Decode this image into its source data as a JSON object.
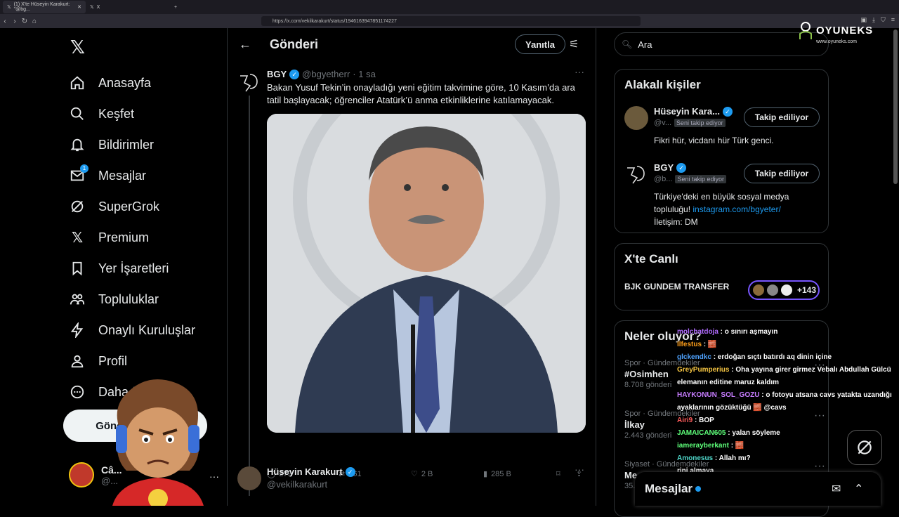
{
  "browser": {
    "active_tab_title": "(1) X'te Hüseyin Karakurt: \"@bg...",
    "second_tab_title": "X",
    "url": "https://x.com/vekilkarakurt/status/1946163947851174227"
  },
  "sidebar": {
    "items": [
      {
        "label": "Anasayfa",
        "icon": "home-icon"
      },
      {
        "label": "Keşfet",
        "icon": "search-icon"
      },
      {
        "label": "Bildirimler",
        "icon": "bell-icon"
      },
      {
        "label": "Mesajlar",
        "icon": "mail-icon",
        "badge": "1"
      },
      {
        "label": "SuperGrok",
        "icon": "grok-icon"
      },
      {
        "label": "Premium",
        "icon": "x-logo-icon"
      },
      {
        "label": "Yer İşaretleri",
        "icon": "bookmark-icon"
      },
      {
        "label": "Topluluklar",
        "icon": "communities-icon"
      },
      {
        "label": "Onaylı Kuruluşlar",
        "icon": "lightning-icon"
      },
      {
        "label": "Profil",
        "icon": "person-icon"
      },
      {
        "label": "Daha fazla",
        "icon": "more-circle-icon"
      }
    ],
    "post_button": "Gönderi yayınla",
    "account_name": "Câ...",
    "account_handle": "@..."
  },
  "main": {
    "title": "Gönderi",
    "reply_button": "Yanıtla",
    "tweet": {
      "name": "BGY",
      "handle": "@bgyetherr",
      "time": "· 1 sa",
      "text": "Bakan Yusuf Tekin’in onayladığı yeni eğitim takvimine göre, 10 Kasım’da ara tatil başlayacak; öğrenciler Atatürk’ü anma etkinliklerine katılamayacak.",
      "replies": "279",
      "reposts": "361",
      "likes": "2 B",
      "views": "285 B"
    },
    "reply": {
      "name": "Hüseyin Karakurt",
      "handle": "@vekilkarakurt"
    }
  },
  "right": {
    "search_placeholder": "Ara",
    "related_title": "Alakalı kişiler",
    "people": [
      {
        "name": "Hüseyin Kara...",
        "handle": "@v...",
        "follows_you": "Seni takip ediyor",
        "button": "Takip ediliyor",
        "bio": "Fikri hür, vicdanı hür Türk genci."
      },
      {
        "name": "BGY",
        "handle": "@b...",
        "follows_you": "Seni takip ediyor",
        "button": "Takip ediliyor",
        "bio_1": "Türkiye'deki en büyük sosyal medya topluluğu!",
        "bio_link": "instagram.com/bgyeter/",
        "bio_2": "İletişim: DM"
      }
    ],
    "live_title": "X'te Canlı",
    "live_item": "BJK GUNDEM TRANSFER",
    "live_count": "+143",
    "trends_title": "Neler oluyor?",
    "trends": [
      {
        "category": "Spor · Gündemdekiler",
        "name": "#Osimhen",
        "count": "8.708 gönderi"
      },
      {
        "category": "Spor · Gündemdekiler",
        "name": "İlkay",
        "count": "2.443 gönderi"
      },
      {
        "category": "Siyaset · Gündemdekiler",
        "name": "Me...",
        "count": "35..."
      }
    ]
  },
  "messages_dock": {
    "title": "Mesajlar"
  },
  "overlay": {
    "brand": "OYUNEKS",
    "brand_url": "www.oyuneks.com",
    "chat": [
      {
        "user": "molchatdoja",
        "msg": ": o sınırı aşmayın",
        "color": "#b16bff"
      },
      {
        "user": "Ilfestus",
        "msg": ": 🧱",
        "color": "#ff9f1a"
      },
      {
        "user": "glckendkc",
        "msg": ": erdoğan sıçtı batırdı aq dinin içine",
        "color": "#4fa3ff"
      },
      {
        "user": "GreyPumperius",
        "msg": ": Oha yayına girer girmez Vebalı Abdullah Gülcü elemanın editine maruz kaldım",
        "color": "#f5c542"
      },
      {
        "user": "HAYKONUN_SOL_GOZU",
        "msg": ": o fotoyu atsana cavs yatakta uzandığı ayaklarının gözüktüğü 🧱 @cavs",
        "color": "#c77dff"
      },
      {
        "user": "Airi9",
        "msg": ": BOP",
        "color": "#ff5c5c"
      },
      {
        "user": "JAMAICAN605",
        "msg": ": yalan söyleme",
        "color": "#5eff7a"
      },
      {
        "user": "iamerayberkant",
        "msg": ": 🧱",
        "color": "#5eff7a"
      },
      {
        "user": "Amonesus",
        "msg": ": Allah mı?",
        "color": "#4fd6c9"
      },
      {
        "user": "",
        "msg": "rini almaya",
        "color": "#ffffff"
      }
    ]
  },
  "colors": {
    "accent": "#1d9bf0",
    "background": "#000000",
    "border": "#2f3336"
  }
}
